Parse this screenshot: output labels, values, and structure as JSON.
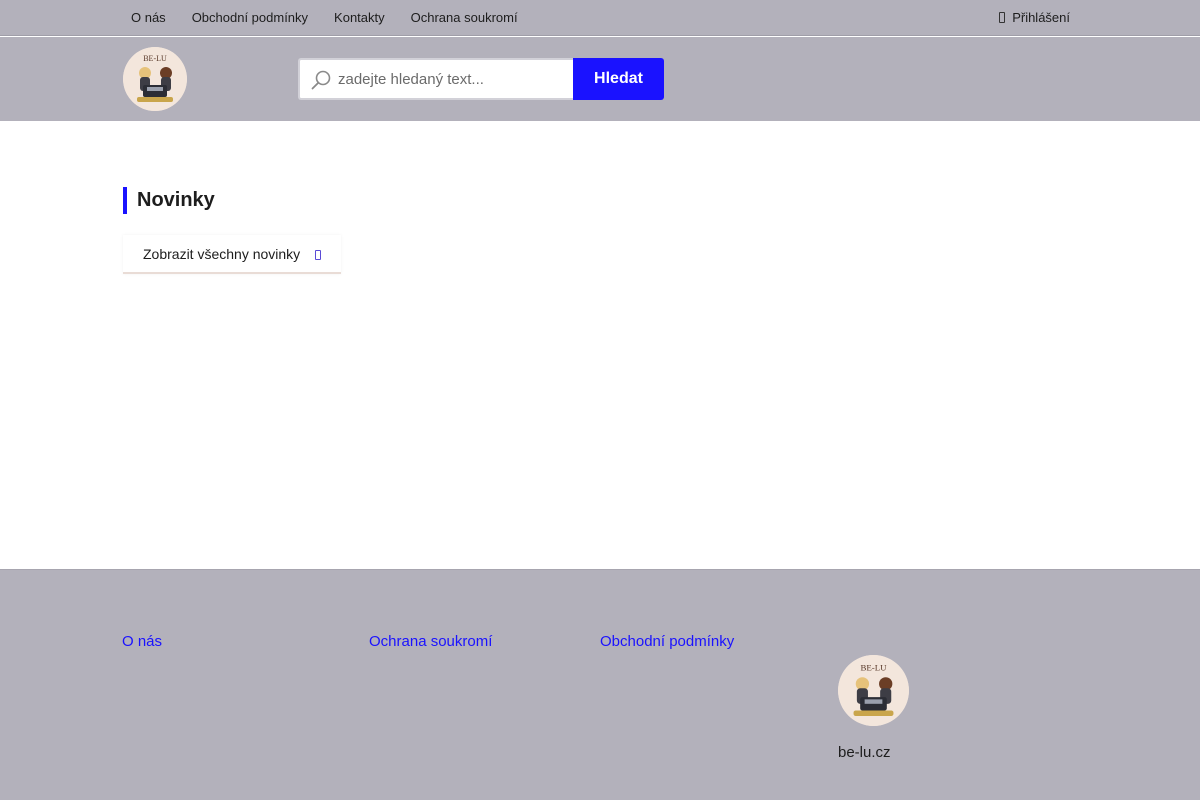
{
  "topnav": {
    "items": [
      "O nás",
      "Obchodní podmínky",
      "Kontakty",
      "Ochrana soukromí"
    ],
    "login_label": "Přihlášení"
  },
  "header": {
    "logo_text": "BE-LU",
    "search_placeholder": "zadejte hledaný text...",
    "search_button": "Hledat"
  },
  "main": {
    "section_title": "Novinky",
    "show_all_news": "Zobrazit všechny novinky"
  },
  "footer": {
    "links": [
      "O nás",
      "Ochrana soukromí",
      "Obchodní podmínky"
    ],
    "logo_text": "BE-LU",
    "domain": "be-lu.cz"
  },
  "colors": {
    "accent": "#1a12ff",
    "bar_background": "#b3b1bb",
    "logo_background": "#f3e6dc"
  }
}
